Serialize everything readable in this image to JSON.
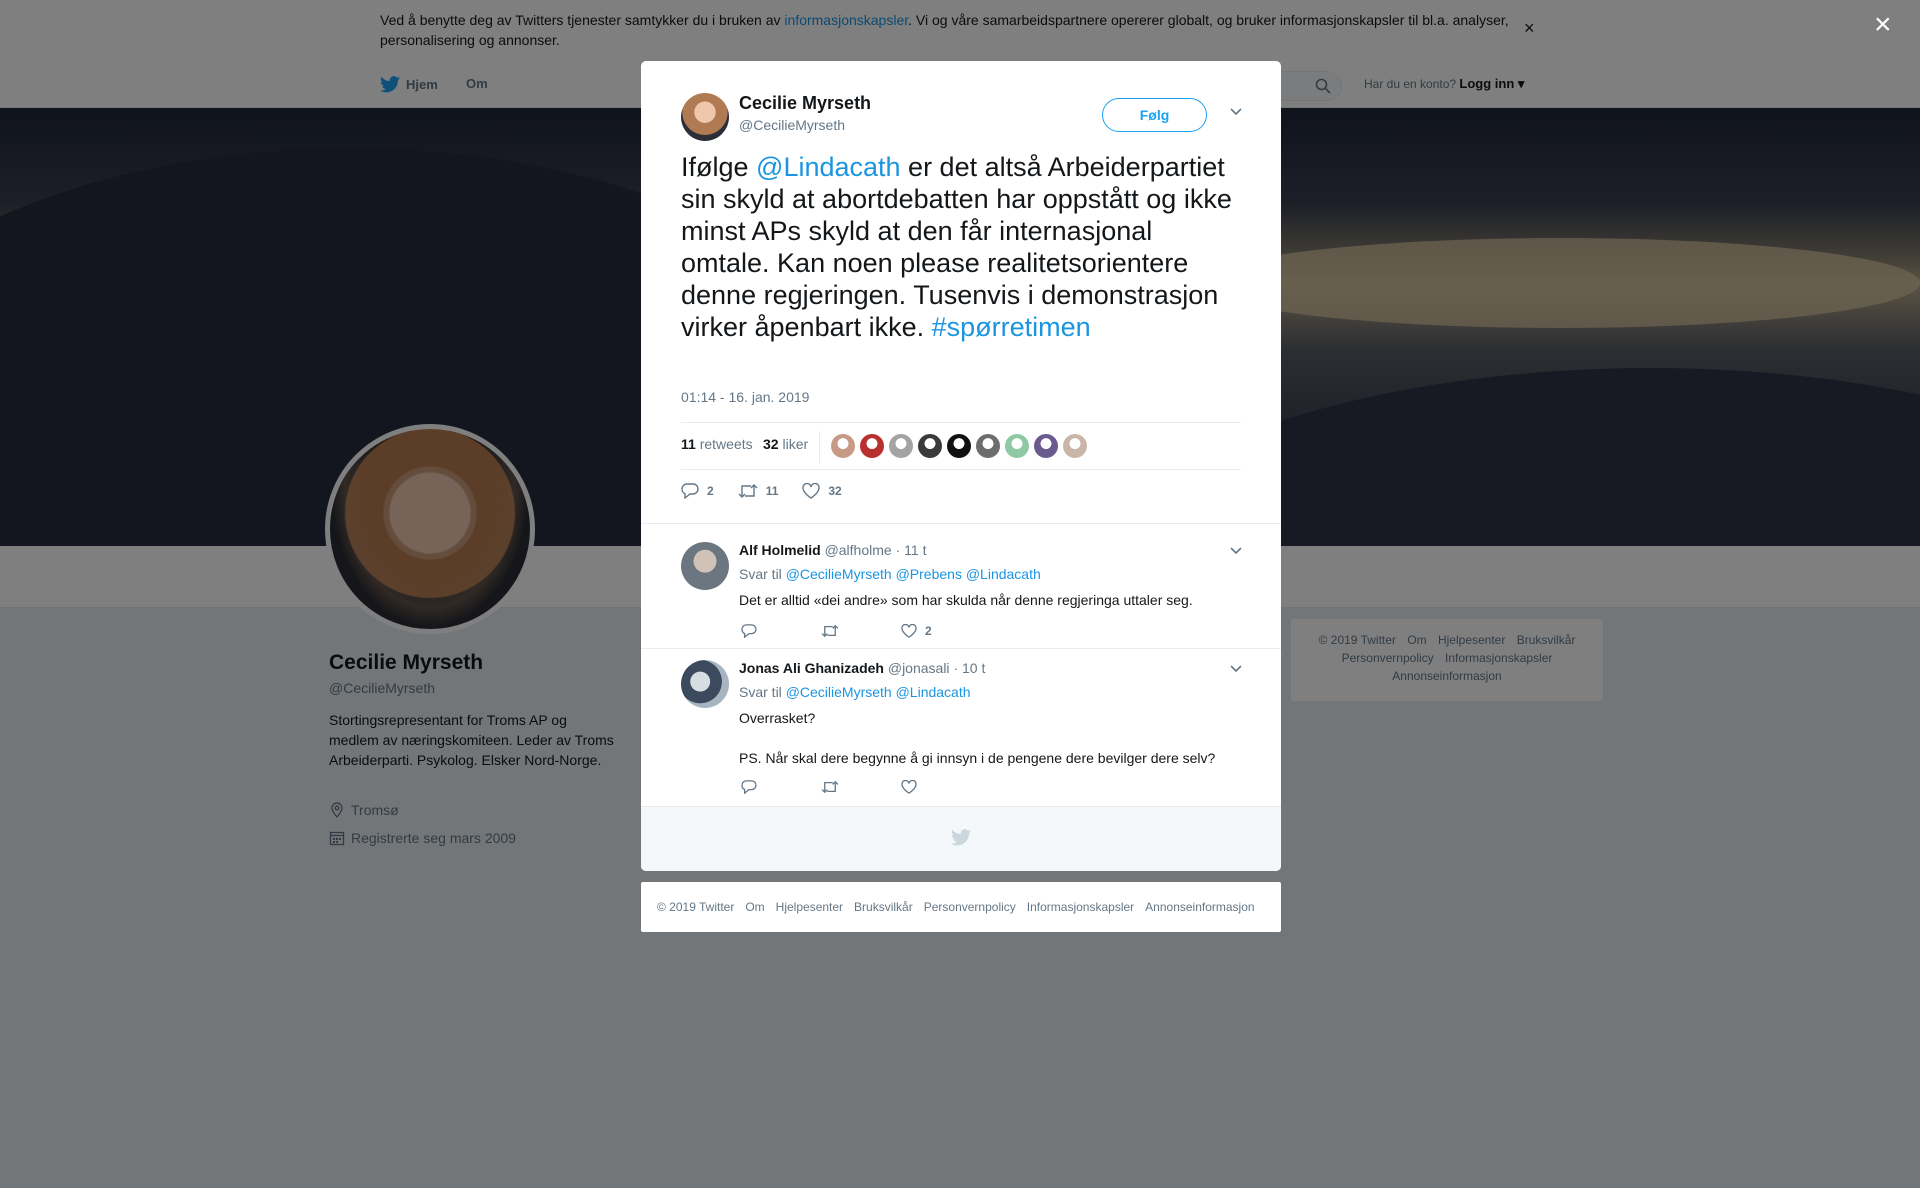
{
  "cookie": {
    "text_before": "Ved å benytte deg av Twitters tjenester samtykker du i bruken av ",
    "link": "informasjonskapsler",
    "text_after": ". Vi og våre samarbeidspartnere opererer globalt, og bruker informasjonskapsler til bl.a. analyser, personalisering og annonser.",
    "close": "×"
  },
  "nav": {
    "home": "Hjem",
    "about": "Om",
    "login_prompt": "Har du en konto?",
    "login": "Logg inn"
  },
  "profile": {
    "name": "Cecilie Myrseth",
    "handle": "@CecilieMyrseth",
    "bio": "Stortingsrepresentant for Troms AP og medlem av næringskomiteen. Leder av Troms Arbeiderparti. Psykolog. Elsker Nord-Norge.",
    "location": "Tromsø",
    "joined": "Registrerte seg mars 2009"
  },
  "side_footer": {
    "line1": [
      "© 2019 Twitter",
      "Om",
      "Hjelpesenter",
      "Bruksvilkår"
    ],
    "line2": [
      "Personvernpolicy",
      "Informasjonskapsler"
    ],
    "line3": [
      "Annonseinformasjon"
    ]
  },
  "overlay_close": "×",
  "tweet": {
    "name": "Cecilie Myrseth",
    "handle": "@CecilieMyrseth",
    "follow": "Følg",
    "text_1": "Ifølge ",
    "mention": "@Lindacath",
    "text_2": " er det altså Arbeiderpartiet sin skyld at abortdebatten har oppstått og ikke minst APs skyld at den får internasjonal omtale. Kan noen please realitetsorientere denne regjeringen. Tusenvis i demonstrasjon virker åpenbart ikke. ",
    "hashtag": "#spørretimen",
    "time": "01:14 - 16. jan. 2019",
    "retweets_count": "11",
    "retweets_label": "retweets",
    "likes_count": "32",
    "likes_label": "liker",
    "liker_colors": [
      "#c89a86",
      "#b8312f",
      "#a3a3a3",
      "#3a3a3a",
      "#111111",
      "#6d6d6d",
      "#8fc9a4",
      "#6b5a8e",
      "#c9b6a8"
    ],
    "replies": "2",
    "retweets": "11",
    "likes": "32"
  },
  "replies": [
    {
      "name": "Alf Holmelid",
      "handle": "@alfholme",
      "time": "· 11 t",
      "to_label": "Svar til",
      "to": [
        "@CecilieMyrseth",
        "@Prebens",
        "@Lindacath"
      ],
      "text": "Det er alltid «dei andre» som har skulda når denne regjeringa uttaler seg.",
      "likes": "2",
      "avatar_color": "#6b7680"
    },
    {
      "name": "Jonas Ali Ghanizadeh",
      "handle": "@jonasali",
      "time": "· 10 t",
      "to_label": "Svar til",
      "to": [
        "@CecilieMyrseth",
        "@Lindacath"
      ],
      "text_1": "Overrasket?",
      "text_2": "PS. Når skal dere begynne å gi innsyn i de pengene dere bevilger dere selv?",
      "likes": "",
      "avatar_color": "#7c8a96"
    }
  ],
  "footer": [
    "© 2019 Twitter",
    "Om",
    "Hjelpesenter",
    "Bruksvilkår",
    "Personvernpolicy",
    "Informasjonskapsler",
    "Annonseinformasjon"
  ],
  "colors": {
    "accent": "#1da1f2",
    "link": "#1b95e0",
    "muted": "#657786"
  }
}
